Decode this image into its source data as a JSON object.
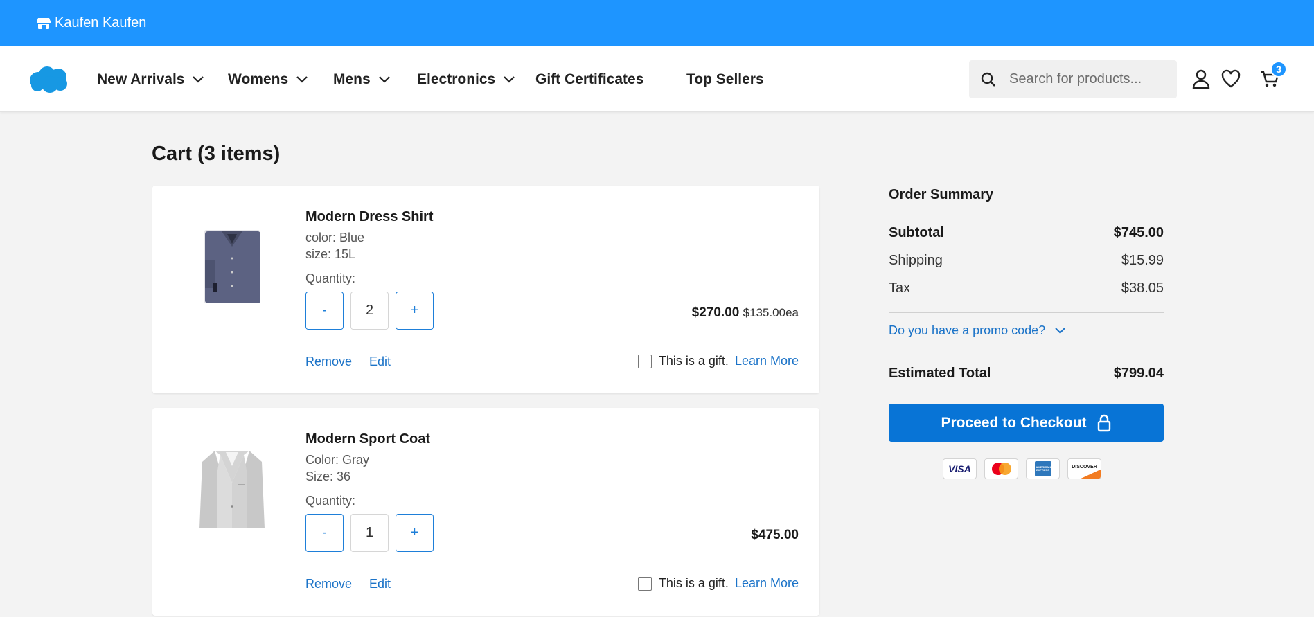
{
  "topbar": {
    "store_name": "Kaufen Kaufen",
    "icon": "store-icon"
  },
  "nav": {
    "logo": "salesforce-cloud-logo",
    "items": [
      {
        "label": "New Arrivals",
        "has_dropdown": true
      },
      {
        "label": "Womens",
        "has_dropdown": true
      },
      {
        "label": "Mens",
        "has_dropdown": true
      },
      {
        "label": "Electronics",
        "has_dropdown": true
      },
      {
        "label": "Gift Certificates",
        "has_dropdown": false
      },
      {
        "label": "Top Sellers",
        "has_dropdown": false
      }
    ],
    "search_placeholder": "Search for products...",
    "icons": [
      "search-icon",
      "account-icon",
      "wishlist-heart-icon",
      "cart-icon"
    ],
    "cart_count": "3"
  },
  "page": {
    "title": "Cart (3 items)"
  },
  "cart_items": [
    {
      "name": "Modern Dress Shirt",
      "attr1": "color: Blue",
      "attr2": "size: 15L",
      "quantity_label": "Quantity:",
      "quantity": "2",
      "minus": "-",
      "plus": "+",
      "total": "$270.00",
      "each": "$135.00ea",
      "remove": "Remove",
      "edit": "Edit",
      "gift": "This is a gift.",
      "learn_more": "Learn More",
      "image": "dress-shirt-image"
    },
    {
      "name": "Modern Sport Coat",
      "attr1": "Color: Gray",
      "attr2": "Size: 36",
      "quantity_label": "Quantity:",
      "quantity": "1",
      "minus": "-",
      "plus": "+",
      "total": "$475.00",
      "each": "",
      "remove": "Remove",
      "edit": "Edit",
      "gift": "This is a gift.",
      "learn_more": "Learn More",
      "image": "sport-coat-image"
    }
  ],
  "summary": {
    "title": "Order Summary",
    "subtotal_label": "Subtotal",
    "subtotal": "$745.00",
    "shipping_label": "Shipping",
    "shipping": "$15.99",
    "tax_label": "Tax",
    "tax": "$38.05",
    "promo": "Do you have a promo code?",
    "total_label": "Estimated Total",
    "total": "$799.04",
    "checkout": "Proceed to Checkout",
    "payment_cards": [
      "visa",
      "mastercard",
      "american-express",
      "discover"
    ],
    "visa_text": "VISA",
    "amex_text": "AMERICAN EXPRESS",
    "discover_text": "DISCOVER"
  },
  "colors": {
    "topbar": "#1e95ff",
    "link": "#1b73c8",
    "checkout": "#0874d6",
    "background": "#f3f3f3"
  }
}
